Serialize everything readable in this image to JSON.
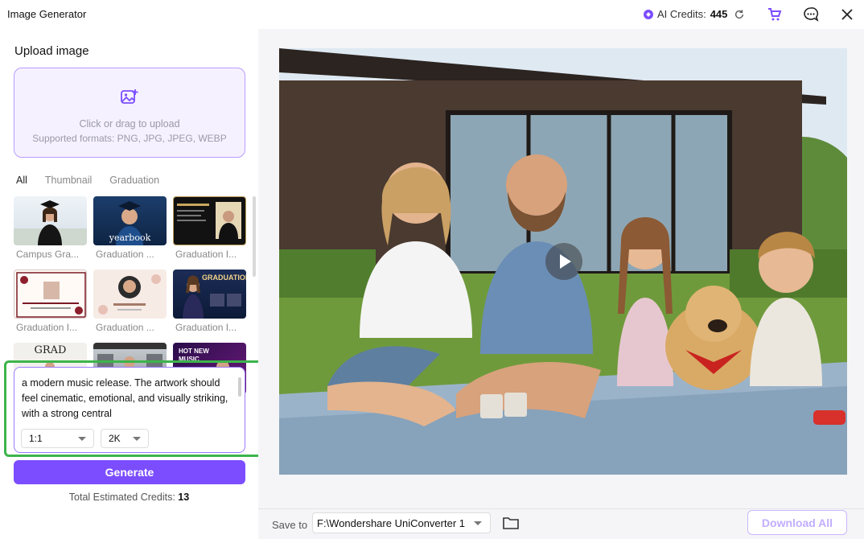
{
  "window": {
    "title": "Image Generator"
  },
  "header": {
    "credits_label": "AI Credits:",
    "credits_value": "445",
    "icons": [
      "credits-gem-icon",
      "refresh-icon",
      "cart-icon",
      "feedback-icon",
      "close-icon"
    ]
  },
  "upload": {
    "title": "Upload image",
    "hint": "Click or drag to upload",
    "formats": "Supported formats: PNG, JPG, JPEG, WEBP"
  },
  "tabs": [
    "All",
    "Thumbnail",
    "Graduation"
  ],
  "active_tab": "All",
  "templates": [
    {
      "label": "Campus Gra..."
    },
    {
      "label": "Graduation ...",
      "art_text": "yearbook"
    },
    {
      "label": "Graduation I..."
    },
    {
      "label": "Graduation I..."
    },
    {
      "label": "Graduation ..."
    },
    {
      "label": "Graduation I...",
      "art_text": "GRADUATION"
    },
    {
      "label": "",
      "art_text": "GRAD"
    },
    {
      "label": ""
    },
    {
      "label": "",
      "art_text": "HOT NEW MUSIC"
    }
  ],
  "prompt": {
    "text": "a modern music release. The artwork should feel cinematic, emotional, and visually striking, with a strong central",
    "aspect_ratio": "1:1",
    "resolution": "2K"
  },
  "actions": {
    "generate_label": "Generate",
    "estimated_label": "Total Estimated Credits:",
    "estimated_value": "13",
    "download_label": "Download All"
  },
  "save": {
    "label": "Save to",
    "path": "F:\\Wondershare UniConverter 1"
  },
  "colors": {
    "accent": "#7b4dff",
    "accent_light": "#f6f1ff",
    "highlight": "#3cb44b"
  }
}
